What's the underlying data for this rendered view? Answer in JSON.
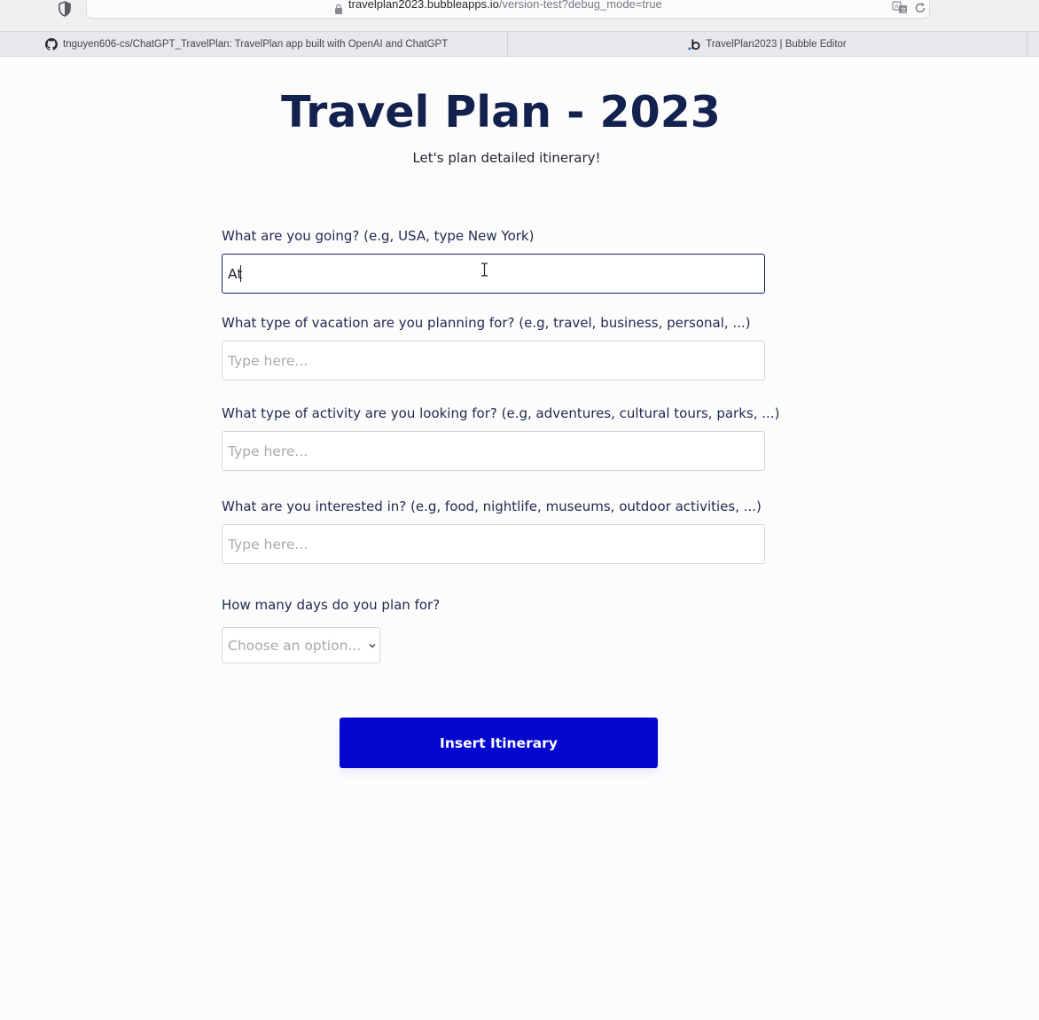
{
  "browser": {
    "url_host": "travelplan2023.bubbleapps.io",
    "url_path": "/version-test?debug_mode=true",
    "tabs": [
      {
        "label": "tnguyen606-cs/ChatGPT_TravelPlan: TravelPlan app built with OpenAI and ChatGPT",
        "icon": "github-icon"
      },
      {
        "label": "TravelPlan2023 | Bubble Editor",
        "icon": "bubble-icon"
      }
    ]
  },
  "header": {
    "title": "Travel Plan - 2023",
    "subtitle": "Let's plan detailed itinerary!"
  },
  "form": {
    "destination": {
      "label": "What are you going? (e.g, USA, type New York)",
      "value": "At"
    },
    "vacation_type": {
      "label": "What type of vacation are you planning for? (e.g, travel, business, personal, ...)",
      "placeholder": "Type here..."
    },
    "activity_type": {
      "label": "What type of activity are you looking for? (e.g, adventures, cultural tours, parks, ...)",
      "placeholder": "Type here..."
    },
    "interests": {
      "label": "What are you interested in? (e.g, food, nightlife, museums, outdoor activities, ...)",
      "placeholder": "Type here..."
    },
    "days": {
      "label": "How many days do you plan for?",
      "placeholder": "Choose an option..."
    },
    "submit_label": "Insert Itinerary"
  },
  "colors": {
    "title": "#13214f",
    "button": "#0307cf",
    "focus_border": "#15206b"
  }
}
